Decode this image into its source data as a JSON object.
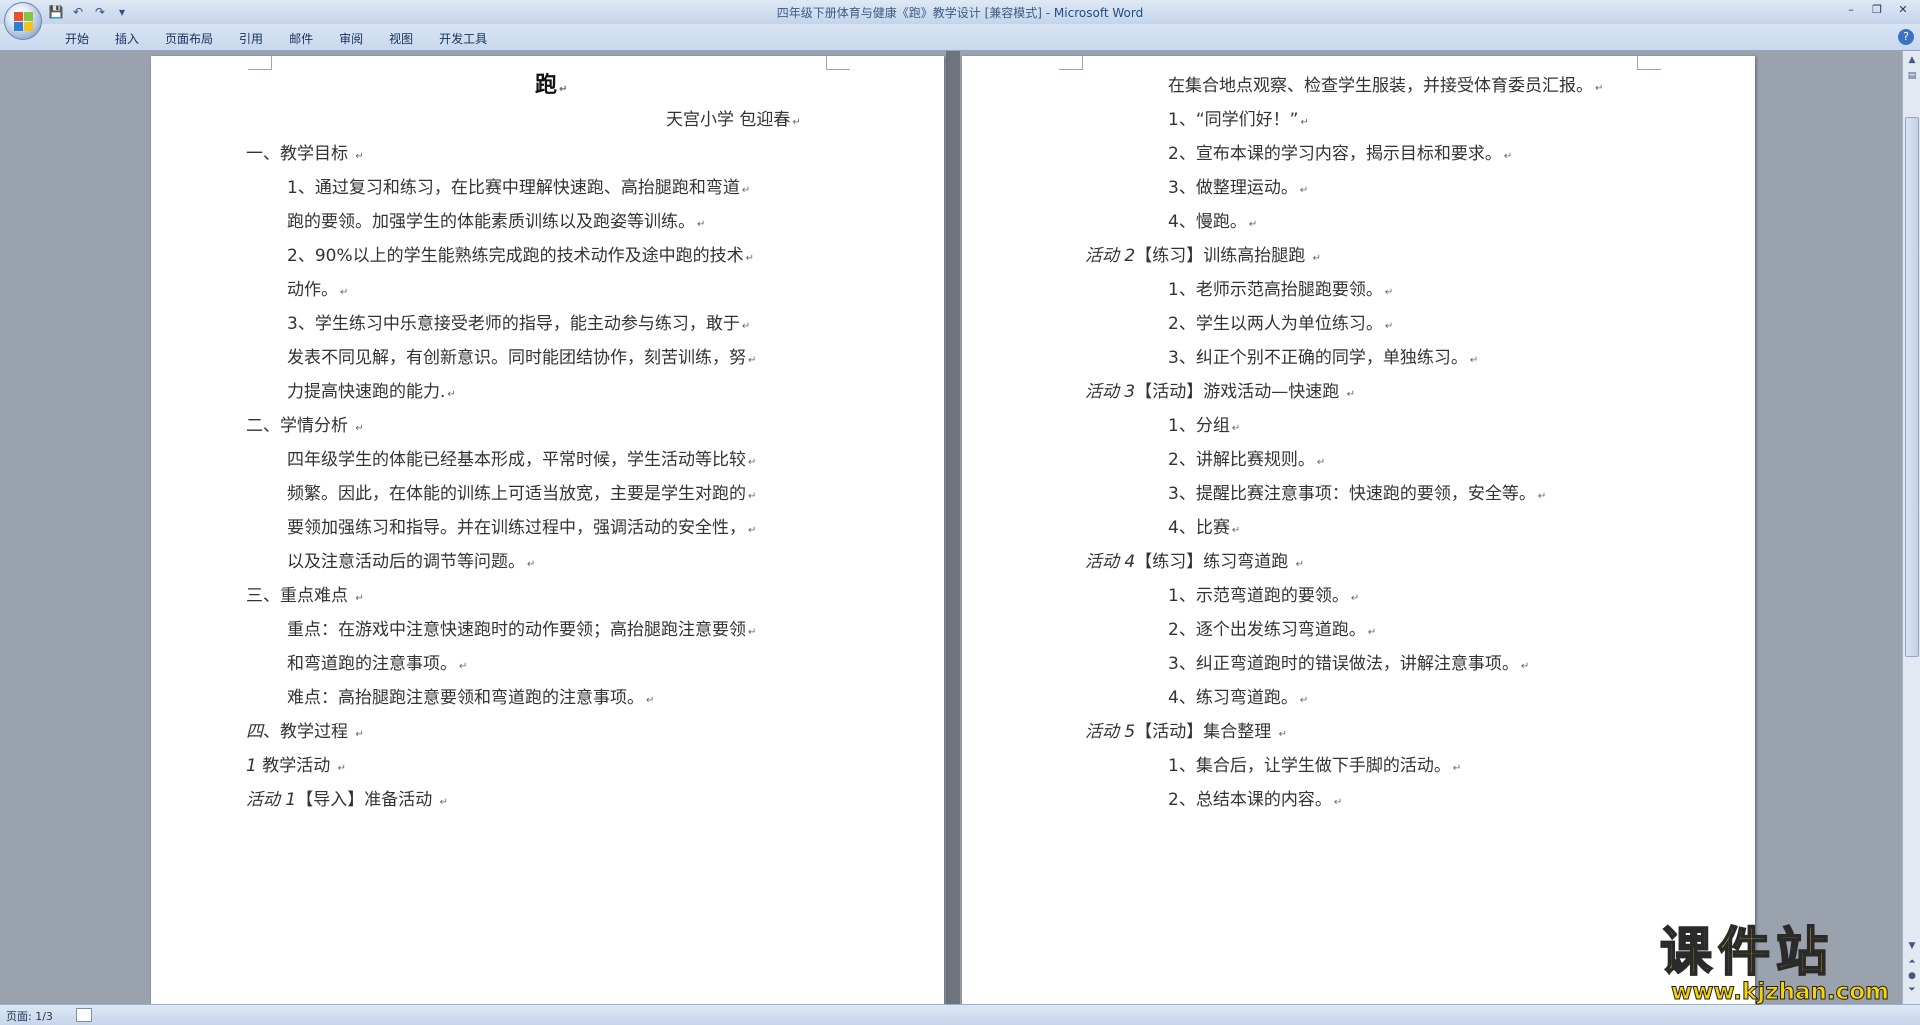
{
  "window": {
    "title": "四年级下册体育与健康《跑》教学设计 [兼容模式] - ",
    "app_name": "Microsoft Word",
    "controls": [
      "–",
      "❐",
      "✕"
    ]
  },
  "qat": {
    "save_icon": "💾",
    "undo_icon": "↶",
    "redo_icon": "↷",
    "customize_icon": "▾"
  },
  "ribbon": {
    "tabs": [
      "开始",
      "插入",
      "页面布局",
      "引用",
      "邮件",
      "审阅",
      "视图",
      "开发工具"
    ],
    "help_icon": "?"
  },
  "page1": {
    "lines": [
      {
        "text": "跑",
        "kind": "title"
      },
      {
        "text": "天宫小学     包迎春"
      },
      {
        "text": "一、教学目标 "
      },
      {
        "text": "1、通过复习和练习，在比赛中理解快速跑、高抬腿跑和弯道"
      },
      {
        "text": "跑的要领。加强学生的体能素质训练以及跑姿等训练。"
      },
      {
        "text": "2、90%以上的学生能熟练完成跑的技术动作及途中跑的技术"
      },
      {
        "text": "动作。"
      },
      {
        "text": "3、学生练习中乐意接受老师的指导，能主动参与练习，敢于"
      },
      {
        "text": "发表不同见解，有创新意识。同时能团结协作，刻苦训练，努"
      },
      {
        "text": "力提高快速跑的能力."
      },
      {
        "text": "二、学情分析 "
      },
      {
        "text": "四年级学生的体能已经基本形成，平常时候，学生活动等比较"
      },
      {
        "text": "频繁。因此，在体能的训练上可适当放宽，主要是学生对跑的"
      },
      {
        "text": "要领加强练习和指导。并在训练过程中，强调活动的安全性，"
      },
      {
        "text": "以及注意活动后的调节等问题。"
      },
      {
        "text": "三、重点难点 "
      },
      {
        "text": "重点：在游戏中注意快速跑时的动作要领；高抬腿跑注意要领"
      },
      {
        "text": "和弯道跑的注意事项。"
      },
      {
        "text": "难点：高抬腿跑注意要领和弯道跑的注意事项。"
      },
      {
        "text_it": "四",
        "text": "、教学过程 "
      },
      {
        "text_it": "1 ",
        "text": "教学活动 "
      },
      {
        "text_it": "活动 1",
        "text": "【导入】准备活动 "
      }
    ]
  },
  "page2": {
    "lines": [
      {
        "text": "在集合地点观察、检查学生服装，并接受体育委员汇报。"
      },
      {
        "text": "1、“同学们好！”"
      },
      {
        "text": "2、宣布本课的学习内容，揭示目标和要求。"
      },
      {
        "text": "3、做整理运动。"
      },
      {
        "text": "4、慢跑。"
      },
      {
        "text_it": "活动 2",
        "text": "【练习】训练高抬腿跑 "
      },
      {
        "text": "1、老师示范高抬腿跑要领。"
      },
      {
        "text": "2、学生以两人为单位练习。"
      },
      {
        "text": "3、纠正个别不正确的同学，单独练习。"
      },
      {
        "text_it": "活动 3",
        "text": "【活动】游戏活动—快速跑 "
      },
      {
        "text": "1、分组"
      },
      {
        "text": "2、讲解比赛规则。"
      },
      {
        "text": "3、提醒比赛注意事项：快速跑的要领，安全等。"
      },
      {
        "text": "4、比赛"
      },
      {
        "text_it": "活动 4",
        "text": "【练习】练习弯道跑 "
      },
      {
        "text": "1、示范弯道跑的要领。"
      },
      {
        "text": "2、逐个出发练习弯道跑。"
      },
      {
        "text": "3、纠正弯道跑时的错误做法，讲解注意事项。"
      },
      {
        "text": "4、练习弯道跑。"
      },
      {
        "text_it": "活动 5",
        "text": "【活动】集合整理 "
      },
      {
        "text": "1、集合后，让学生做下手脚的活动。"
      },
      {
        "text": "2、总结本课的内容。"
      }
    ]
  },
  "paragraph_mark": "↵",
  "status": {
    "page_info": "页面: 1/3"
  },
  "watermark": {
    "name": "课件站",
    "url": "www.kjzhan.com"
  }
}
